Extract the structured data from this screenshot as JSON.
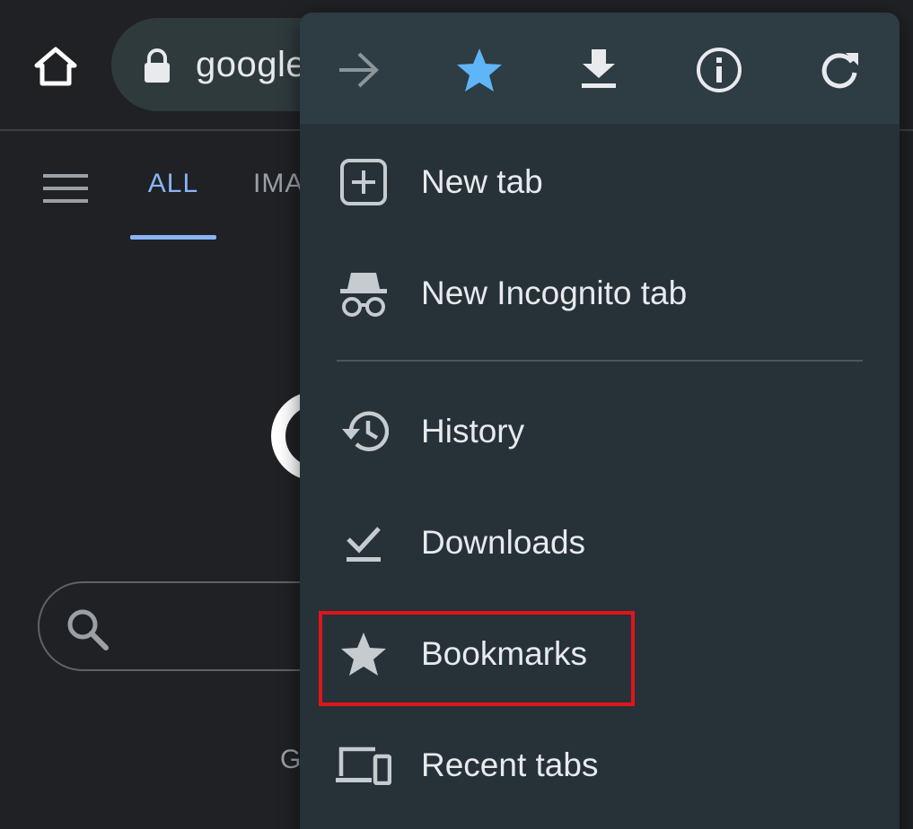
{
  "toolbar": {
    "url_text": "google"
  },
  "page": {
    "tabs": [
      {
        "label": "ALL",
        "selected": true
      },
      {
        "label": "IMA",
        "selected": false
      }
    ],
    "footer_letter": "G"
  },
  "menu": {
    "icon_bar": [
      {
        "icon": "forward-arrow-icon",
        "enabled": false
      },
      {
        "icon": "star-filled-icon",
        "active": true
      },
      {
        "icon": "download-icon"
      },
      {
        "icon": "info-icon"
      },
      {
        "icon": "refresh-icon"
      }
    ],
    "items": [
      {
        "label": "New tab",
        "icon": "new-tab-icon"
      },
      {
        "label": "New Incognito tab",
        "icon": "incognito-icon"
      },
      {
        "label": "History",
        "icon": "history-icon"
      },
      {
        "label": "Downloads",
        "icon": "downloads-icon"
      },
      {
        "label": "Bookmarks",
        "icon": "star-icon",
        "highlighted": true
      },
      {
        "label": "Recent tabs",
        "icon": "devices-icon"
      }
    ]
  },
  "colors": {
    "background": "#1f2124",
    "menu_background": "#263238",
    "menu_iconbar": "#2e3c43",
    "accent_blue": "#8ab4f8",
    "star_active": "#5eb5f7",
    "highlight": "#e0141d"
  }
}
